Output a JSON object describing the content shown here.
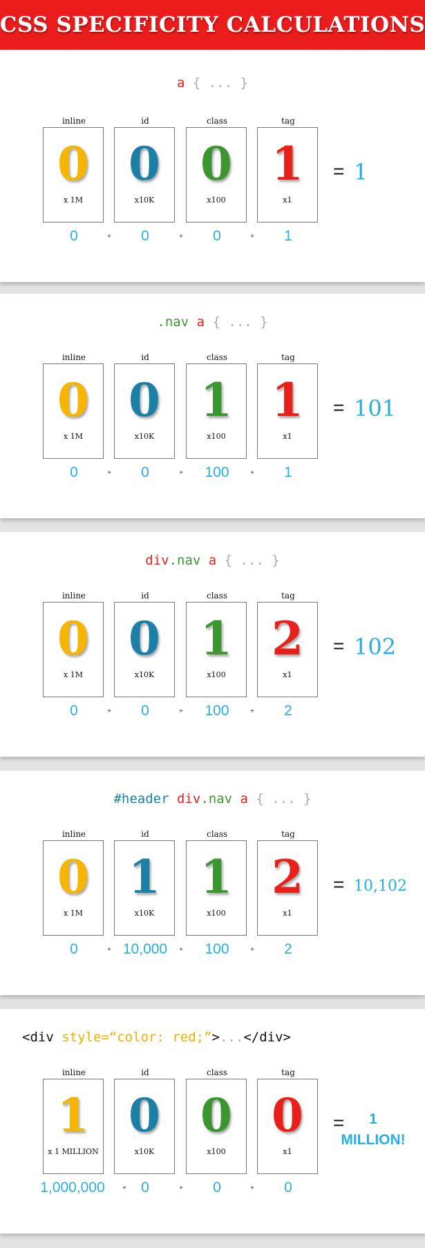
{
  "title": "CSS SPECIFICITY CALCULATIONS",
  "colors": {
    "header_bg": "#ea1c1c",
    "inline": "#f7b500",
    "id": "#1b7fa6",
    "class": "#3c9630",
    "tag": "#e8201a",
    "result": "#27aee2",
    "brace": "#aaaaaa",
    "attr": "#f0b000"
  },
  "column_labels": [
    "inline",
    "id",
    "class",
    "tag"
  ],
  "multipliers": [
    "x 1M",
    "x10K",
    "x100",
    "x1"
  ],
  "examples": [
    {
      "selector": [
        {
          "text": "a",
          "color": "#e8201a"
        },
        {
          "text": " { ... }",
          "color": "#aaaaaa"
        }
      ],
      "digits": [
        "0",
        "0",
        "0",
        "1"
      ],
      "inline_multiplier": "x 1M",
      "summands": [
        "0",
        "0",
        "0",
        "1"
      ],
      "equals": "=",
      "total": "1"
    },
    {
      "selector": [
        {
          "text": ".nav",
          "color": "#3c9630"
        },
        {
          "text": " a",
          "color": "#e8201a"
        },
        {
          "text": " { ... }",
          "color": "#aaaaaa"
        }
      ],
      "digits": [
        "0",
        "0",
        "1",
        "1"
      ],
      "inline_multiplier": "x 1M",
      "summands": [
        "0",
        "0",
        "100",
        "1"
      ],
      "equals": "=",
      "total": "101"
    },
    {
      "selector": [
        {
          "text": "div",
          "color": "#e8201a"
        },
        {
          "text": ".nav",
          "color": "#3c9630"
        },
        {
          "text": " a",
          "color": "#e8201a"
        },
        {
          "text": " { ... }",
          "color": "#aaaaaa"
        }
      ],
      "digits": [
        "0",
        "0",
        "1",
        "2"
      ],
      "inline_multiplier": "x 1M",
      "summands": [
        "0",
        "0",
        "100",
        "2"
      ],
      "equals": "=",
      "total": "102"
    },
    {
      "selector": [
        {
          "text": "#header",
          "color": "#1b7fa6"
        },
        {
          "text": " div",
          "color": "#e8201a"
        },
        {
          "text": ".nav",
          "color": "#3c9630"
        },
        {
          "text": " a",
          "color": "#e8201a"
        },
        {
          "text": " { ... }",
          "color": "#aaaaaa"
        }
      ],
      "digits": [
        "0",
        "1",
        "1",
        "2"
      ],
      "inline_multiplier": "x 1M",
      "summands": [
        "0",
        "10,000",
        "100",
        "2"
      ],
      "equals": "=",
      "total": "10,102"
    },
    {
      "selector": [
        {
          "text": "<div ",
          "color": "#111111"
        },
        {
          "text": "style=“color: red;”",
          "color": "#f0b000"
        },
        {
          "text": ">",
          "color": "#111111"
        },
        {
          "text": "...",
          "color": "#aaaaaa"
        },
        {
          "text": "</div>",
          "color": "#111111"
        }
      ],
      "digits": [
        "1",
        "0",
        "0",
        "0"
      ],
      "inline_multiplier": "x 1 MILLION",
      "summands": [
        "1,000,000",
        "0",
        "0",
        "0"
      ],
      "equals": "=",
      "total_lines": [
        "1",
        "MILLION!"
      ]
    }
  ]
}
